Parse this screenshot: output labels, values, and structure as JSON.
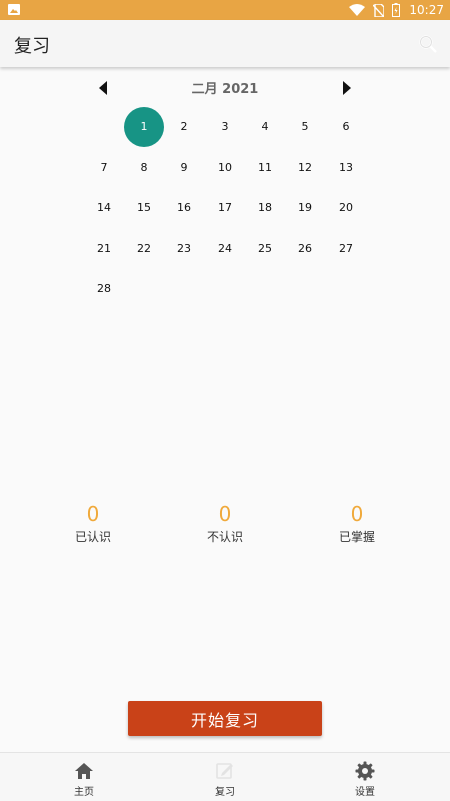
{
  "status_bar": {
    "time": "10:27",
    "icons": [
      "gallery-icon",
      "wifi-icon",
      "no-sim-icon",
      "battery-icon"
    ]
  },
  "app_bar": {
    "title": "复习",
    "search_icon": "search-icon"
  },
  "calendar": {
    "month_label": "二月 2021",
    "selected_day": "1",
    "days": [
      "1",
      "2",
      "3",
      "4",
      "5",
      "6",
      "7",
      "8",
      "9",
      "10",
      "11",
      "12",
      "13",
      "14",
      "15",
      "16",
      "17",
      "18",
      "19",
      "20",
      "21",
      "22",
      "23",
      "24",
      "25",
      "26",
      "27",
      "28"
    ],
    "accent": "#179485"
  },
  "stats": [
    {
      "value": "0",
      "label": "已认识"
    },
    {
      "value": "0",
      "label": "不认识"
    },
    {
      "value": "0",
      "label": "已掌握"
    }
  ],
  "start_button": {
    "label": "开始复习",
    "color": "#c94218"
  },
  "bottom_nav": [
    {
      "label": "主页",
      "icon": "home-icon"
    },
    {
      "label": "复习",
      "icon": "review-icon"
    },
    {
      "label": "设置",
      "icon": "gear-icon"
    }
  ],
  "colors": {
    "status_bar": "#e8a544",
    "stat_number": "#f0a93a"
  }
}
